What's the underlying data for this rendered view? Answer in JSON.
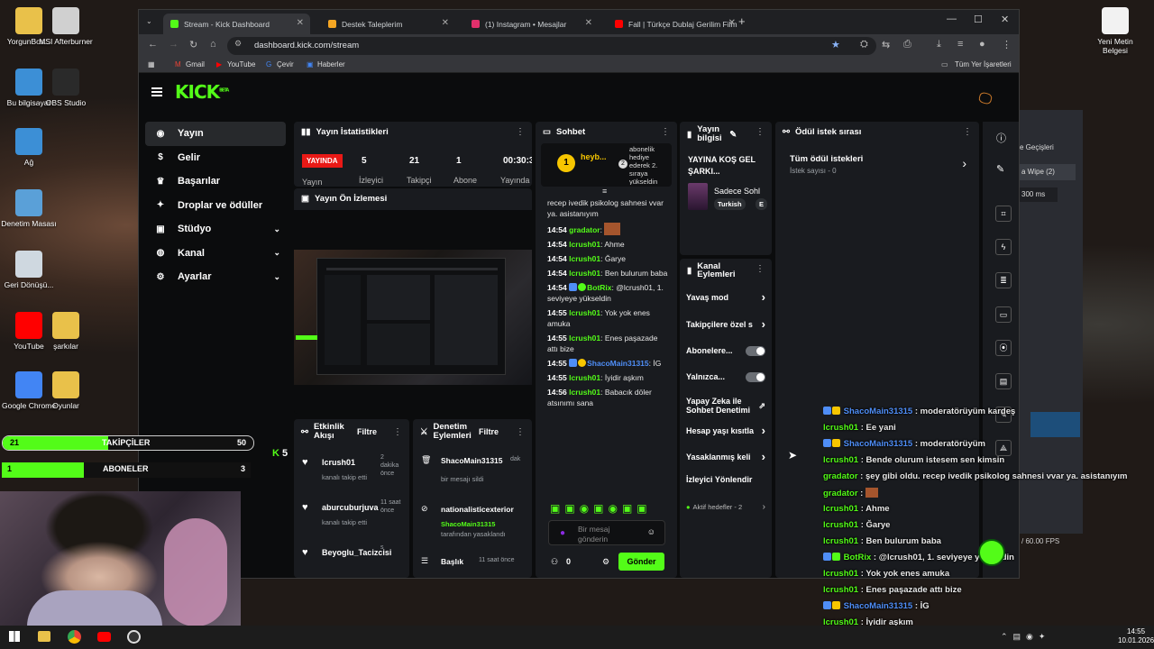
{
  "desktop": {
    "icons": [
      {
        "label": "YorgunBos...",
        "color": "#e9c14a"
      },
      {
        "label": "MSI Afterburner",
        "color": "#d0d0d0"
      },
      {
        "label": "Bu bilgisayar",
        "color": "#3c8fd6"
      },
      {
        "label": "OBS Studio",
        "color": "#2a2a2a"
      },
      {
        "label": "Ağ",
        "color": "#3c8fd6"
      },
      {
        "label": "Denetim Masası",
        "color": "#5aa0d8"
      },
      {
        "label": "Geri Dönüşü...",
        "color": "#cfd8e0"
      },
      {
        "label": "YouTube",
        "color": "#ff0000"
      },
      {
        "label": "şarkılar",
        "color": "#e9c14a"
      },
      {
        "label": "Google Chrome",
        "color": "#4285f4"
      },
      {
        "label": "Oyunlar",
        "color": "#e9c14a"
      },
      {
        "label": "Yeni Metin Belgesi",
        "color": "#f2f2f2"
      }
    ]
  },
  "browser": {
    "tabs": [
      {
        "label": "Stream - Kick Dashboard",
        "color": "#53fc18"
      },
      {
        "label": "Destek Taleplerim",
        "color": "#f5a623"
      },
      {
        "label": "(1) Instagram • Mesajlar",
        "color": "#e1306c"
      },
      {
        "label": "Fall | Türkçe Dublaj Gerilim Film",
        "color": "#ff0000"
      }
    ],
    "url": "dashboard.kick.com/stream",
    "bookmarks": [
      "Gmail",
      "YouTube",
      "Çevir",
      "Haberler"
    ],
    "all_bookmarks": "Tüm Yer İşaretleri"
  },
  "kick": {
    "logo": "KICK",
    "logo_sup": "BETA",
    "nav": [
      {
        "label": "Yayın",
        "icon": "broadcast-icon"
      },
      {
        "label": "Gelir",
        "icon": "dollar-icon"
      },
      {
        "label": "Başarılar",
        "icon": "trophy-icon"
      },
      {
        "label": "Droplar ve ödüller",
        "icon": "gift-icon"
      },
      {
        "label": "Stüdyo",
        "icon": "camera-icon"
      },
      {
        "label": "Kanal",
        "icon": "user-icon"
      },
      {
        "label": "Ayarlar",
        "icon": "gear-icon"
      }
    ],
    "stats": {
      "title": "Yayın İstatistikleri",
      "live": "YAYINDA",
      "live_sub": "Yayın",
      "items": [
        {
          "value": "5",
          "label": "İzleyici"
        },
        {
          "value": "21",
          "label": "Takipçi"
        },
        {
          "value": "1",
          "label": "Abone"
        },
        {
          "value": "00:30:3",
          "label": "Yayında"
        }
      ]
    },
    "preview": {
      "title": "Yayın Ön İzlemesi"
    },
    "activity": {
      "title": "Etkinlik Akışı",
      "filter": "Filtre",
      "items": [
        {
          "user": "lcrush01",
          "sub": "kanalı takip etti",
          "time": "2 dakika önce"
        },
        {
          "user": "aburcuburjuva",
          "sub": "kanalı takip etti",
          "time": "11 saat önce"
        },
        {
          "user": "Beyoglu_Tacizcisi",
          "sub": "",
          "time": "s"
        }
      ]
    },
    "moderation": {
      "title": "Denetim Eylemleri",
      "filter": "Filtre",
      "items": [
        {
          "user": "ShacoMain31315",
          "sub": "bir mesajı sildi",
          "time": "dak"
        },
        {
          "user": "nationalisticexterior",
          "sub_user": "ShacoMain31315",
          "sub": "tarafından yasaklandı",
          "time": ""
        },
        {
          "user": "Başlık",
          "sub": "",
          "time": "11 saat önce"
        }
      ]
    },
    "chat": {
      "title": "Sohbet",
      "pinned_user": "heyb...",
      "pinned_count": "1",
      "pinned_gift": "abonelik hediye ederek 2. sıraya yükseldin",
      "top_text": "recep ivedik psikolog sahnesi vvar ya. asistanıyım",
      "messages": [
        {
          "time": "14:54",
          "user": "gradator",
          "text": "",
          "user_color": "green"
        },
        {
          "time": "14:54",
          "user": "lcrush01",
          "text": "Ahme",
          "user_color": "green"
        },
        {
          "time": "14:54",
          "user": "lcrush01",
          "text": "Ğarye",
          "user_color": "green"
        },
        {
          "time": "14:54",
          "user": "lcrush01",
          "text": "Ben bulurum baba",
          "user_color": "green"
        },
        {
          "time": "14:54",
          "user": "BotRix",
          "text": "@lcrush01, 1. seviyeye yükseldin",
          "user_color": "green"
        },
        {
          "time": "14:55",
          "user": "lcrush01",
          "text": "Yok yok enes amuka",
          "user_color": "green"
        },
        {
          "time": "14:55",
          "user": "lcrush01",
          "text": "Enes paşazade attı bize",
          "user_color": "green"
        },
        {
          "time": "14:55",
          "user": "ShacoMain31315",
          "text": "İG",
          "user_color": "blue"
        },
        {
          "time": "14:55",
          "user": "lcrush01",
          "text": "İyidir aşkım",
          "user_color": "green"
        },
        {
          "time": "14:56",
          "user": "lcrush01",
          "text": "Babacık döler atsınımı sana",
          "user_color": "green"
        }
      ],
      "input_placeholder": "Bir mesaj gönderin",
      "count": "0",
      "send": "Gönder"
    },
    "info": {
      "title": "Yayın bilgisi",
      "stream_title": "YAYINA KOŞ GEL ŞARKI...",
      "category": "Sadece Sohl",
      "tag1": "Turkish",
      "tag2": "E"
    },
    "actions": {
      "title": "Kanal Eylemleri",
      "items": [
        {
          "label": "Yavaş mod",
          "type": "arrow"
        },
        {
          "label": "Takipçilere özel s",
          "type": "arrow"
        },
        {
          "label": "Abonelere...",
          "type": "toggle"
        },
        {
          "label": "Yalnızca...",
          "type": "toggle"
        },
        {
          "label": "Yapay Zeka ile Sohbet Denetimi",
          "type": "link"
        },
        {
          "label": "Hesap yaşı kısıtla",
          "type": "arrow"
        },
        {
          "label": "Yasaklanmış keli",
          "type": "arrow"
        },
        {
          "label": "İzleyici Yönlendir",
          "type": "none"
        }
      ],
      "goals": "Aktif hedefler - 2"
    },
    "rewards": {
      "title": "Ödül istek sırası",
      "all": "Tüm ödül istekleri",
      "count": "İstek sayısı - 0"
    }
  },
  "widgets": {
    "followers_label": "TAKİPÇİLER",
    "followers_value": "50",
    "followers_current": "21",
    "followers_progress": 0.42,
    "subs_label": "ABONELER",
    "subs_value": "3",
    "subs_current": "1",
    "subs_progress": 0.33,
    "viewer_count": "5"
  },
  "overlay_chat": [
    {
      "user": "ShacoMain31315",
      "text": "moderatörüyüm kardeş",
      "color": "b"
    },
    {
      "user": "lcrush01",
      "text": "Ee yani",
      "color": "g"
    },
    {
      "user": "ShacoMain31315",
      "text": "moderatörüyüm",
      "color": "b"
    },
    {
      "user": "lcrush01",
      "text": "Bende olurum istesem sen kimsin",
      "color": "g"
    },
    {
      "user": "gradator",
      "text": "şey gibi oldu. recep ivedik psikolog sahnesi vvar ya. asistanıyım",
      "color": "g"
    },
    {
      "user": "gradator",
      "text": "",
      "color": "g"
    },
    {
      "user": "lcrush01",
      "text": "Ahme",
      "color": "g"
    },
    {
      "user": "lcrush01",
      "text": "Ğarye",
      "color": "g"
    },
    {
      "user": "lcrush01",
      "text": "Ben bulurum baba",
      "color": "g"
    },
    {
      "user": "BotRix",
      "text": "@lcrush01, 1. seviyeye yükseldin",
      "color": "g"
    },
    {
      "user": "lcrush01",
      "text": "Yok yok enes amuka",
      "color": "g"
    },
    {
      "user": "lcrush01",
      "text": "Enes paşazade attı bize",
      "color": "g"
    },
    {
      "user": "ShacoMain31315",
      "text": "İG",
      "color": "b"
    },
    {
      "user": "lcrush01",
      "text": "İyidir aşkım",
      "color": "g"
    },
    {
      "user": "lcrush01",
      "text": "Babacık döler atsınımı sana",
      "color": "g"
    }
  ],
  "obs": {
    "transitions": "e Geçişleri",
    "wipe": "a Wipe (2)",
    "ms": "300 ms",
    "fps": "/ 60.00 FPS"
  },
  "taskbar": {
    "time": "14:55",
    "date": "10.01.2026"
  }
}
